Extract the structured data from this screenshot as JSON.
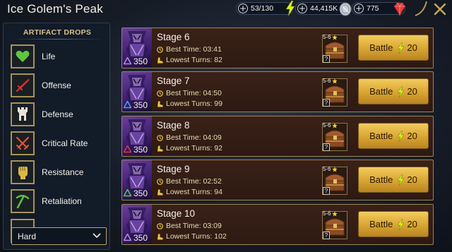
{
  "header": {
    "title": "Ice Golem's Peak",
    "resources": [
      {
        "value": "53/130",
        "icon": "energy-bolt-icon"
      },
      {
        "value": "44,415K",
        "icon": "silver-coin-icon"
      },
      {
        "value": "775",
        "icon": "ruby-gem-icon"
      }
    ]
  },
  "sidebar": {
    "title": "ARTIFACT DROPS",
    "items": [
      {
        "label": "Life",
        "icon": "heart-icon",
        "color": "#5ec53c"
      },
      {
        "label": "Offense",
        "icon": "sword-icon",
        "color": "#d8322a"
      },
      {
        "label": "Defense",
        "icon": "tower-icon",
        "color": "#e9e3d4"
      },
      {
        "label": "Critical Rate",
        "icon": "crossed-swords-icon",
        "color": "#e4572e"
      },
      {
        "label": "Resistance",
        "icon": "fist-icon",
        "color": "#d9b84a"
      },
      {
        "label": "Retaliation",
        "icon": "pickaxe-icon",
        "color": "#5ec53c"
      }
    ],
    "difficulty": "Hard"
  },
  "stages": [
    {
      "name": "Stage 6",
      "level": "350",
      "best_time_label": "Best Time:",
      "best_time": "03:41",
      "lowest_turns_label": "Lowest Turns:",
      "lowest_turns": "82",
      "drop_range": "5-6",
      "battle_label": "Battle",
      "energy_cost": "20",
      "affinity": "void",
      "affinity_color": "#b78be8"
    },
    {
      "name": "Stage 7",
      "level": "350",
      "best_time_label": "Best Time:",
      "best_time": "04:50",
      "lowest_turns_label": "Lowest Turns:",
      "lowest_turns": "99",
      "drop_range": "5-6",
      "battle_label": "Battle",
      "energy_cost": "20",
      "affinity": "magic",
      "affinity_color": "#4aa3ff"
    },
    {
      "name": "Stage 8",
      "level": "350",
      "best_time_label": "Best Time:",
      "best_time": "04:09",
      "lowest_turns_label": "Lowest Turns:",
      "lowest_turns": "92",
      "drop_range": "5-6",
      "battle_label": "Battle",
      "energy_cost": "20",
      "affinity": "force",
      "affinity_color": "#e2383a"
    },
    {
      "name": "Stage 9",
      "level": "350",
      "best_time_label": "Best Time:",
      "best_time": "02:52",
      "lowest_turns_label": "Lowest Turns:",
      "lowest_turns": "94",
      "drop_range": "5-6",
      "battle_label": "Battle",
      "energy_cost": "20",
      "affinity": "spirit",
      "affinity_color": "#4cd04a"
    },
    {
      "name": "Stage 10",
      "level": "350",
      "best_time_label": "Best Time:",
      "best_time": "03:09",
      "lowest_turns_label": "Lowest Turns:",
      "lowest_turns": "102",
      "drop_range": "5-6",
      "battle_label": "Battle",
      "energy_cost": "20",
      "affinity": "void",
      "affinity_color": "#b78be8"
    }
  ]
}
